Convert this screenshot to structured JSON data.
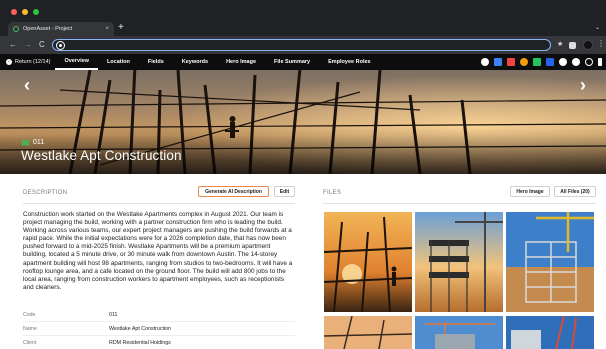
{
  "browser": {
    "tab_title": "OpenAsset - Project",
    "tab_close": "×",
    "new_tab": "+",
    "tab_menu": "⌄",
    "back": "←",
    "forward": "→",
    "reload": "C",
    "url": "",
    "menu": "⋮",
    "traffic_colors": [
      "#ff5f57",
      "#febc2e",
      "#28c840"
    ]
  },
  "app_nav": {
    "return_label": "Return (12/14)",
    "tabs": [
      {
        "label": "Overview",
        "active": true
      },
      {
        "label": "Location"
      },
      {
        "label": "Fields"
      },
      {
        "label": "Keywords"
      },
      {
        "label": "Hero Image"
      },
      {
        "label": "File Summary"
      },
      {
        "label": "Employee Roles"
      }
    ],
    "icon_colors": [
      "#ffffff",
      "#3b82f6",
      "#ef4444",
      "#f59e0b",
      "#22c55e",
      "#ffffff",
      "#ffffff",
      "#ffffff"
    ]
  },
  "hero": {
    "prev": "‹",
    "next": "›",
    "project_code": "011",
    "project_name": "Westlake Apt Construction"
  },
  "description": {
    "section_label": "DESCRIPTION",
    "generate_button": "Generate AI Description",
    "edit_button": "Edit",
    "text": "Construction work started on the Westlake Apartments complex in August 2021. Our team is project managing the build, working with a partner construction firm who is leading the build. Working across various teams, our expert project managers are pushing the build forwards at a rapid pace. While the initial expectations were for a 2026 completion date, that has now been pushed forward to a mid-2025 finish. Westlake Apartments will be a premium apartment building, located a 5 minute drive, or 30 minute walk from downtown Austin. The 14-storey apartment building will host 98 apartments, ranging from studios to two-bedrooms. It will have a rooftop lounge area, and a cafe located on the ground floor. The build will add 800 jobs to the local area, ranging from construction workers to apartment employees, such as receptionists and cleaners."
  },
  "fields": [
    {
      "label": "Code",
      "value": "011"
    },
    {
      "label": "Name",
      "value": "Westlake Apt Construction"
    },
    {
      "label": "Client",
      "value": "RDM Residential Holdings"
    }
  ],
  "files": {
    "section_label": "FILES",
    "hero_image_button": "Hero Image",
    "all_files_button": "All Files (20)"
  },
  "colors": {
    "accent_orange": "#e8894b",
    "nav_bg": "#0d0d0d",
    "chrome_bg": "#202124"
  }
}
